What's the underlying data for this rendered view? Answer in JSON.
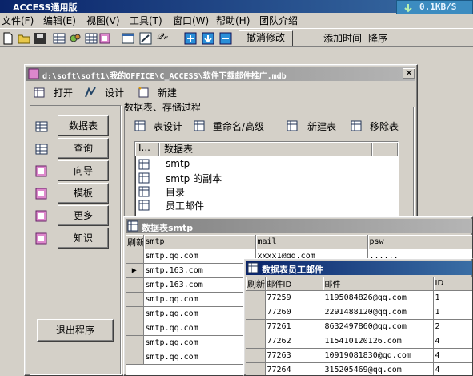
{
  "app": {
    "title": "ACCESS通用版",
    "speed": "0.1KB/S"
  },
  "menu": [
    "文件(F)",
    "编辑(E)",
    "视图(V)",
    "工具(T)",
    "窗口(W)",
    "帮助(H)",
    "团队介绍"
  ],
  "toolbar": {
    "undo_label": "撤消修改",
    "add_time_label": "添加时间",
    "sort_desc_label": "降序"
  },
  "db_window": {
    "title": "d:\\soft\\soft1\\我的OFFICE\\C_ACCESS\\软件下载邮件推广.mdb",
    "open_label": "打开",
    "design_label": "设计",
    "new_label": "新建",
    "group_label": "数据表、存储过程",
    "nav": [
      "数据表",
      "查询",
      "向导",
      "模板",
      "更多",
      "知识"
    ],
    "exit_label": "退出程序",
    "actions": [
      "表设计",
      "重命名/高级",
      "新建表",
      "移除表"
    ],
    "list_headers": [
      "I...",
      "数据表"
    ],
    "tables": [
      "smtp",
      "smtp 的副本",
      "目录",
      "员工邮件"
    ]
  },
  "smtp_window": {
    "title": "数据表smtp",
    "refresh": "刷新",
    "headers": [
      "smtp",
      "mail",
      "psw"
    ],
    "header2_val": "......",
    "mail_partial": "xxxx1@qq.com",
    "rows": [
      "smtp.qq.com",
      "smtp.163.com",
      "smtp.163.com",
      "smtp.qq.com",
      "smtp.qq.com",
      "smtp.qq.com",
      "smtp.qq.com",
      "smtp.qq.com"
    ]
  },
  "emp_window": {
    "title": "数据表员工邮件",
    "refresh": "刷新",
    "headers": [
      "邮件ID",
      "邮件",
      "ID"
    ],
    "rows": [
      [
        "77259",
        "1195084826@qq.com",
        "1"
      ],
      [
        "77260",
        "2291488120@qq.com",
        "1"
      ],
      [
        "77261",
        "8632497860@qq.com",
        "2"
      ],
      [
        "77262",
        "115410120126.com",
        "4"
      ],
      [
        "77263",
        "10919081830@qq.com",
        "4"
      ],
      [
        "77264",
        "315205469@qq.com",
        "4"
      ]
    ]
  }
}
